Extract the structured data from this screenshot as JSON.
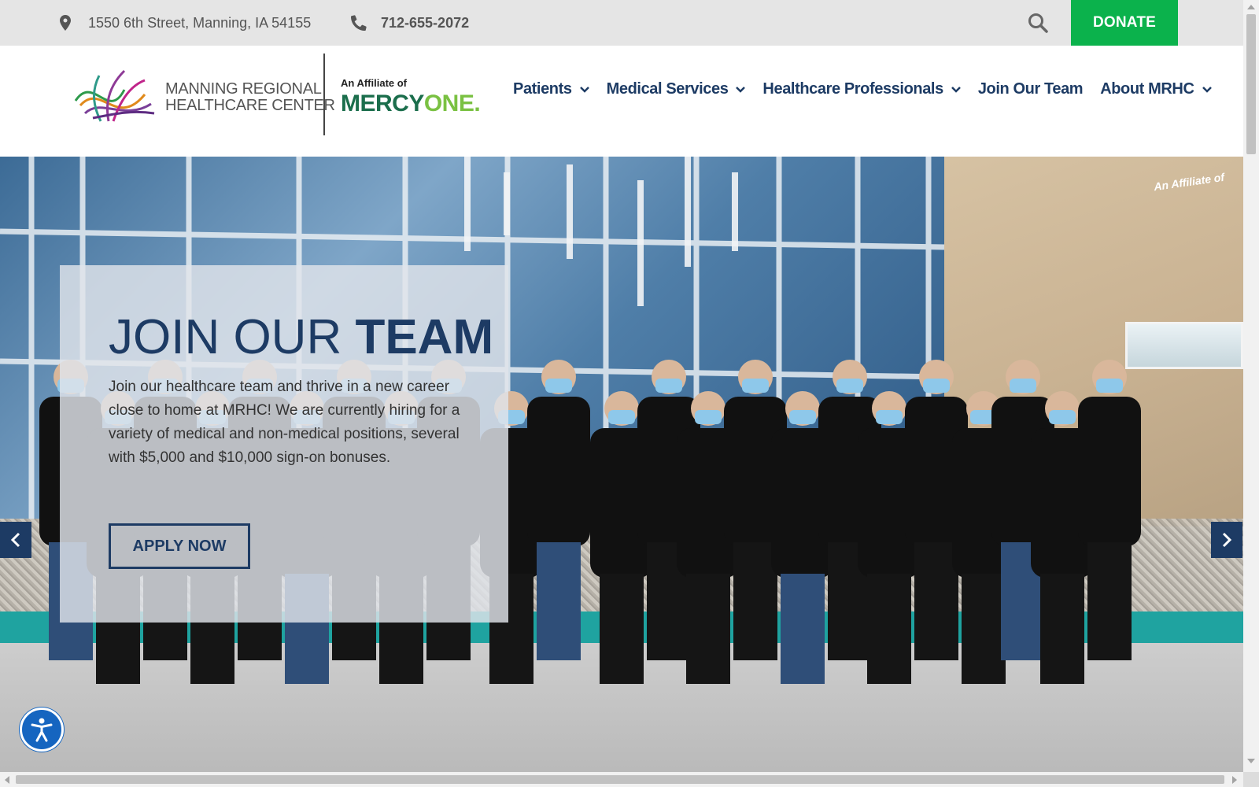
{
  "topbar": {
    "address": "1550 6th Street, Manning, IA 54155",
    "phone": "712-655-2072",
    "donate_label": "DONATE",
    "icons": {
      "address": "map-pin-icon",
      "phone": "phone-icon",
      "search": "search-icon"
    }
  },
  "header": {
    "logo_line1": "MANNING REGIONAL",
    "logo_line2": "HEALTHCARE CENTER",
    "affiliate_label": "An Affiliate of",
    "affiliate_brand_part1": "MERCY",
    "affiliate_brand_part2": "ONE",
    "affiliate_brand_suffix": "."
  },
  "nav": {
    "items": [
      {
        "label": "Patients",
        "has_dropdown": true
      },
      {
        "label": "Medical Services",
        "has_dropdown": true
      },
      {
        "label": "Healthcare Professionals",
        "has_dropdown": true
      },
      {
        "label": "Join Our Team",
        "has_dropdown": false
      },
      {
        "label": "About MRHC",
        "has_dropdown": true
      }
    ]
  },
  "hero": {
    "title_light": "JOIN OUR ",
    "title_bold": "TEAM",
    "body": "Join our healthcare team and thrive in a new career close to home at MRHC! We are currently hiring for a variety of medical and non-medical positions, several with $5,000 and $10,000 sign-on bonuses.",
    "cta_label": "APPLY NOW",
    "building_sign": "An Affiliate of"
  },
  "colors": {
    "brand_navy": "#1d3b64",
    "donate_green": "#0bb24c",
    "topbar_bg": "#e5e5e5",
    "a11y_blue": "#1565c0"
  }
}
